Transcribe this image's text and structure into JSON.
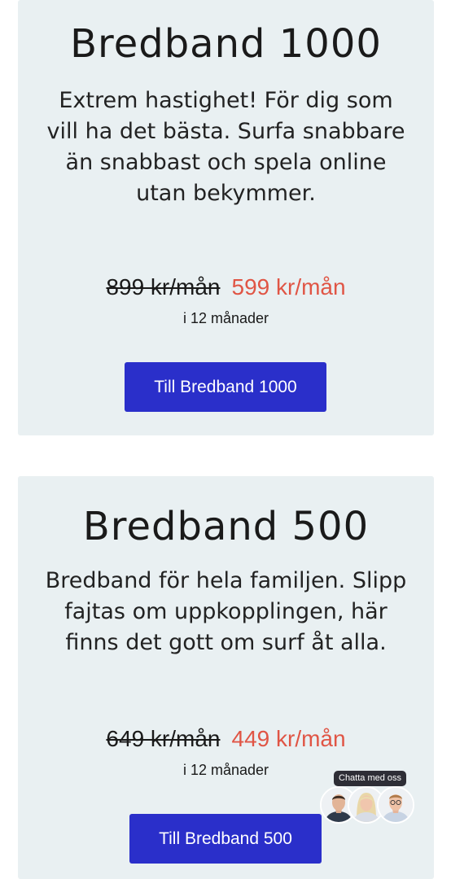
{
  "plans": [
    {
      "title": "Bredband 1000",
      "description": "Extrem hastighet! För dig som vill ha det bästa. Surfa snabbare än snabbast och spela online utan bekymmer.",
      "old_price": "899 kr/mån",
      "new_price": "599 kr/mån",
      "period": "i 12 månader",
      "button_label": "Till Bredband 1000"
    },
    {
      "title": "Bredband 500",
      "description": "Bredband för hela familjen. Slipp fajtas om uppkopplingen, här finns det gott om surf åt alla.",
      "old_price": "649 kr/mån",
      "new_price": "449 kr/mån",
      "period": "i 12 månader",
      "button_label": "Till Bredband 500"
    }
  ],
  "chat": {
    "label": "Chatta med oss",
    "avatars": [
      "person-icon",
      "person-icon",
      "person-icon"
    ]
  },
  "colors": {
    "card_bg": "#e9f0f2",
    "button_bg": "#2a2fca",
    "sale_price": "#e05545",
    "chat_label_bg": "#2e2e36"
  }
}
